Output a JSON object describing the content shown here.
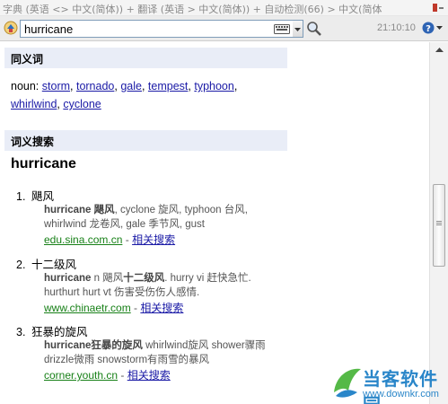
{
  "window": {
    "title": "字典 (英语 <> 中文(简体)) + 翻译 (英语 > 中文(简体)) + 自动检测(66) > 中文(简体"
  },
  "toolbar": {
    "search_value": "hurricane",
    "clock": "21:10:10"
  },
  "synonyms": {
    "header": "同义词",
    "pos": "noun: ",
    "words": [
      "storm",
      "tornado",
      "gale",
      "tempest",
      "typhoon",
      "whirlwind",
      "cyclone"
    ]
  },
  "search": {
    "header": "词义搜索",
    "headword": "hurricane",
    "related_label": "相关搜索",
    "results": [
      {
        "num": "1.",
        "title": "飓风",
        "snippet_bold": "hurricane 飓风",
        "snippet_rest": ", cyclone 旋风, typhoon 台风, whirlwind 龙卷风, gale 季节风, gust",
        "source": "edu.sina.com.cn"
      },
      {
        "num": "2.",
        "title": "十二级风",
        "snippet_bold": "hurricane",
        "snippet_mid": " n 飓风",
        "snippet_bold2": "十二级风",
        "snippet_rest": ". hurry vi 赶快急忙. hurthurt hurt vt 伤害受伤伤人感情.",
        "source": "www.chinaetr.com"
      },
      {
        "num": "3.",
        "title": "狂暴的旋风",
        "snippet_bold": "hurricane狂暴的旋风",
        "snippet_rest": " whirlwind旋风 shower骤雨 drizzle微雨 snowstorm有雨雪的暴风",
        "source": "corner.youth.cn"
      }
    ]
  },
  "watermark": {
    "main": "当客软件园",
    "sub": "www.downkr.com"
  },
  "colors": {
    "link": "#1a1aa6",
    "source_link": "#178017",
    "section_bg": "#e9edf7",
    "watermark": "#2a86c9"
  }
}
